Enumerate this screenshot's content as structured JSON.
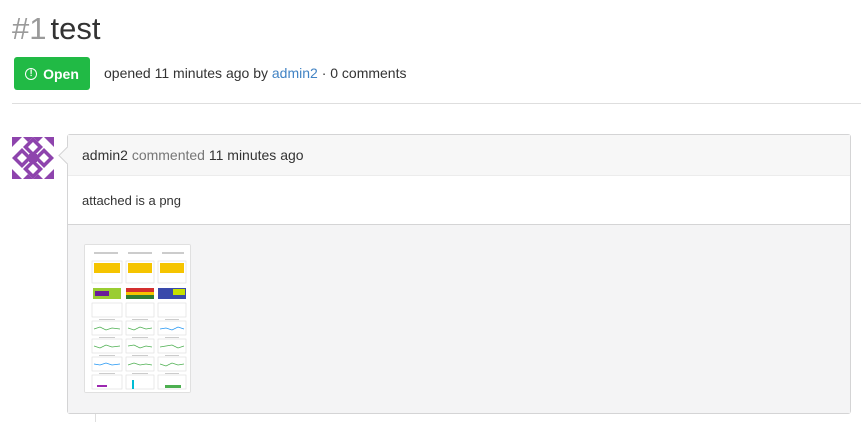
{
  "issue": {
    "number": "#1",
    "title": "test",
    "status": "Open",
    "meta": {
      "opened_text": "opened 11 minutes ago by",
      "author": "admin2",
      "comments_text": "· 0 comments"
    }
  },
  "comment": {
    "author": "admin2",
    "action": "commented",
    "time": "11 minutes ago",
    "body": "attached is a png"
  },
  "colors": {
    "open_badge": "#21ba45",
    "link": "#4183c4",
    "avatar": "#8e44ad"
  },
  "icons": {
    "status": "exclamation-circle-icon",
    "avatar": "identicon"
  }
}
